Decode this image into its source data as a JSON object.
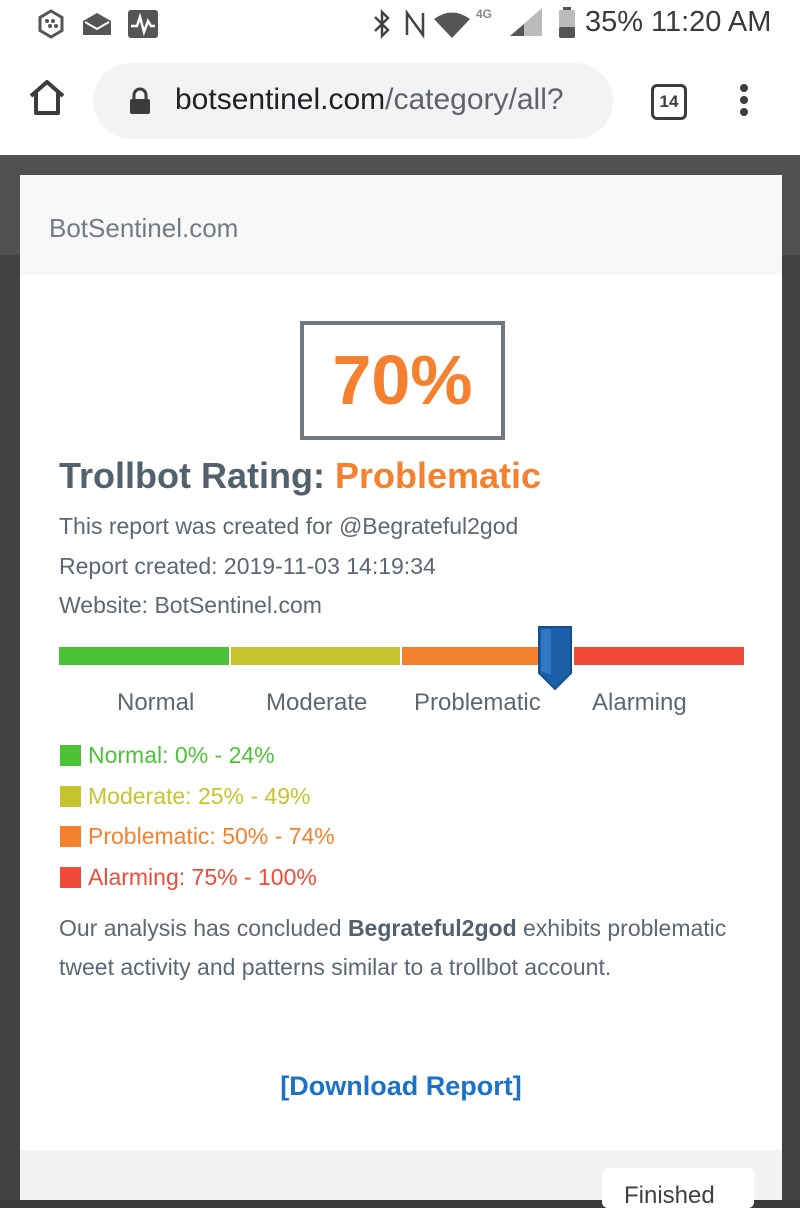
{
  "status_bar": {
    "battery_percent": "35%",
    "time": "11:20 AM",
    "network": "4G"
  },
  "browser": {
    "url_host": "botsentinel.com",
    "url_path": "/category/all?",
    "tab_count": "14"
  },
  "modal": {
    "site_title": "BotSentinel.com",
    "score": "70%",
    "rating_label": "Trollbot Rating: ",
    "rating_value": "Problematic",
    "report_for": "This report was created for @Begrateful2god",
    "report_created": "Report created: 2019-11-03 14:19:34",
    "website": "Website: BotSentinel.com",
    "scale_labels": [
      "Normal",
      "Moderate",
      "Problematic",
      "Alarming"
    ],
    "score_fraction": 0.7,
    "legend": [
      {
        "text": "Normal: 0% - 24%",
        "color": "#4cc336"
      },
      {
        "text": "Moderate: 25% - 49%",
        "color": "#c7c32f"
      },
      {
        "text": "Problematic: 50% - 74%",
        "color": "#f5812f"
      },
      {
        "text": "Alarming: 75% - 100%",
        "color": "#f24a3a"
      }
    ],
    "analysis_prefix": "Our analysis has concluded ",
    "analysis_account": "Begrateful2god",
    "analysis_suffix": " exhibits problematic tweet activity and patterns similar to a trollbot account.",
    "download_label": "[Download Report]",
    "finished_button": "Finished"
  },
  "colors": {
    "accent_orange": "#f5812f",
    "link_blue": "#1a73c8",
    "marker_blue": "#1b5fa8"
  },
  "icons": [
    "blackberry-icon",
    "mail-icon",
    "activity-icon",
    "bluetooth-icon",
    "nfc-icon",
    "wifi-icon",
    "signal-icon",
    "battery-icon",
    "home-icon",
    "lock-icon",
    "menu-icon"
  ]
}
